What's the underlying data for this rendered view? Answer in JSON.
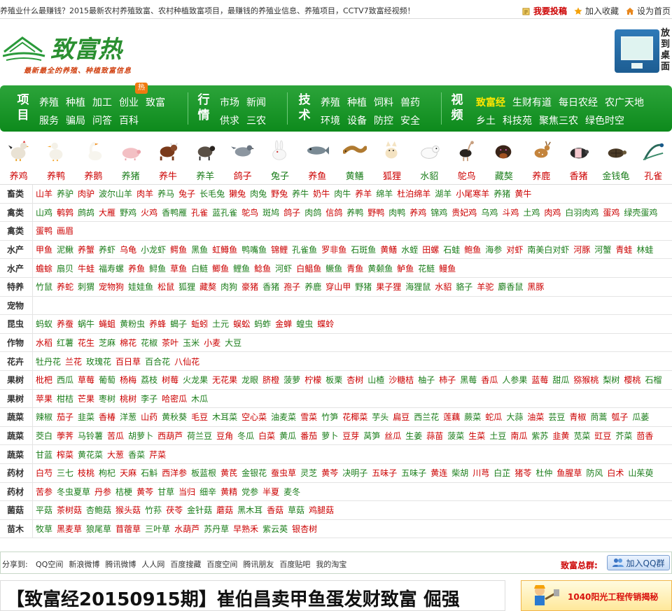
{
  "topbar": {
    "intro": "养殖业什么最赚钱？2015最新农村养殖致富、农村种植致富项目，最赚钱的养殖业信息、养殖项目，CCTV7致富经视频！",
    "submit": "我要投稿",
    "favorite": "加入收藏",
    "homepage": "设为首页"
  },
  "header": {
    "logo_slogan": "最新最全的养殖、种植致富信息",
    "desktop_label": "放到桌面"
  },
  "nav": {
    "groups": [
      {
        "title": "项目",
        "r1": [
          "养殖",
          "种植",
          "加工",
          "创业",
          "致富"
        ],
        "r2": [
          "服务",
          "骗局",
          "问答",
          "百科"
        ]
      },
      {
        "title": "行情",
        "r1": [
          "市场",
          "新闻"
        ],
        "r2": [
          "供求",
          "三农"
        ]
      },
      {
        "title": "技术",
        "r1": [
          "养殖",
          "种植",
          "饲料",
          "兽药"
        ],
        "r2": [
          "环境",
          "设备",
          "防控",
          "安全"
        ]
      },
      {
        "title": "视频",
        "r1": [
          "致富经",
          "生财有道",
          "每日农经",
          "农广天地"
        ],
        "r2": [
          "乡土",
          "科技苑",
          "聚焦三农",
          "绿色时空"
        ]
      }
    ],
    "hot_badge": "热"
  },
  "animals": [
    {
      "label": "养鸡",
      "color": "red",
      "icon": "chicken-icon"
    },
    {
      "label": "养鸭",
      "color": "red",
      "icon": "duck-icon"
    },
    {
      "label": "养鹅",
      "color": "red",
      "icon": "goose-icon"
    },
    {
      "label": "养猪",
      "color": "grn",
      "icon": "pig-icon"
    },
    {
      "label": "养牛",
      "color": "red",
      "icon": "cow-icon"
    },
    {
      "label": "养羊",
      "color": "grn",
      "icon": "sheep-icon"
    },
    {
      "label": "鸽子",
      "color": "red",
      "icon": "pigeon-icon"
    },
    {
      "label": "兔子",
      "color": "grn",
      "icon": "rabbit-icon"
    },
    {
      "label": "养鱼",
      "color": "red",
      "icon": "fish-icon"
    },
    {
      "label": "黄鳝",
      "color": "grn",
      "icon": "eel-icon"
    },
    {
      "label": "狐狸",
      "color": "red",
      "icon": "fox-icon"
    },
    {
      "label": "水貂",
      "color": "grn",
      "icon": "mink-icon"
    },
    {
      "label": "鸵鸟",
      "color": "red",
      "icon": "ostrich-icon"
    },
    {
      "label": "藏獒",
      "color": "grn",
      "icon": "mastiff-icon"
    },
    {
      "label": "养鹿",
      "color": "red",
      "icon": "deer-icon"
    },
    {
      "label": "香猪",
      "color": "red",
      "icon": "minipig-icon"
    },
    {
      "label": "金钱龟",
      "color": "grn",
      "icon": "turtle-icon"
    },
    {
      "label": "孔雀",
      "color": "red",
      "icon": "peacock-icon"
    }
  ],
  "categories": [
    {
      "label": "畜类",
      "items": [
        [
          "山羊",
          "r"
        ],
        [
          "养驴",
          "g"
        ],
        [
          "肉驴",
          "r"
        ],
        [
          "波尔山羊",
          "g"
        ],
        [
          "肉羊",
          "r"
        ],
        [
          "养马",
          "g"
        ],
        [
          "兔子",
          "r"
        ],
        [
          "长毛兔",
          "g"
        ],
        [
          "獭兔",
          "r"
        ],
        [
          "肉兔",
          "g"
        ],
        [
          "野兔",
          "r"
        ],
        [
          "养牛",
          "g"
        ],
        [
          "奶牛",
          "r"
        ],
        [
          "肉牛",
          "g"
        ],
        [
          "养羊",
          "r"
        ],
        [
          "绵羊",
          "g"
        ],
        [
          "杜泊绵羊",
          "r"
        ],
        [
          "湖羊",
          "g"
        ],
        [
          "小尾寒羊",
          "r"
        ],
        [
          "养猪",
          "g"
        ],
        [
          "黄牛",
          "r"
        ]
      ]
    },
    {
      "label": "禽类",
      "items": [
        [
          "山鸡",
          "g"
        ],
        [
          "鹌鹑",
          "r"
        ],
        [
          "鹧鸪",
          "g"
        ],
        [
          "大雁",
          "r"
        ],
        [
          "野鸡",
          "g"
        ],
        [
          "火鸡",
          "r"
        ],
        [
          "香鸭雁",
          "g"
        ],
        [
          "孔雀",
          "r"
        ],
        [
          "蓝孔雀",
          "g"
        ],
        [
          "鸵鸟",
          "r"
        ],
        [
          "斑鸠",
          "g"
        ],
        [
          "鸽子",
          "r"
        ],
        [
          "肉鸽",
          "g"
        ],
        [
          "信鸽",
          "r"
        ],
        [
          "养鸭",
          "g"
        ],
        [
          "野鸭",
          "r"
        ],
        [
          "肉鸭",
          "g"
        ],
        [
          "养鸡",
          "r"
        ],
        [
          "锦鸡",
          "g"
        ],
        [
          "贵妃鸡",
          "r"
        ],
        [
          "乌鸡",
          "g"
        ],
        [
          "斗鸡",
          "r"
        ],
        [
          "土鸡",
          "g"
        ],
        [
          "肉鸡",
          "r"
        ],
        [
          "白羽肉鸡",
          "g"
        ],
        [
          "蛋鸡",
          "r"
        ],
        [
          "绿壳蛋鸡",
          "g"
        ]
      ]
    },
    {
      "label": "禽类",
      "items": [
        [
          "蛋鸭",
          "r"
        ],
        [
          "画眉",
          "r"
        ]
      ]
    },
    {
      "label": "水产",
      "items": [
        [
          "甲鱼",
          "r"
        ],
        [
          "泥鳅",
          "g"
        ],
        [
          "养蟹",
          "r"
        ],
        [
          "养虾",
          "g"
        ],
        [
          "乌龟",
          "r"
        ],
        [
          "小龙虾",
          "g"
        ],
        [
          "鳄鱼",
          "r"
        ],
        [
          "黑鱼",
          "g"
        ],
        [
          "虹鳟鱼",
          "r"
        ],
        [
          "鸭嘴鱼",
          "g"
        ],
        [
          "锦鲤",
          "r"
        ],
        [
          "孔雀鱼",
          "g"
        ],
        [
          "罗非鱼",
          "r"
        ],
        [
          "石斑鱼",
          "g"
        ],
        [
          "黄鳝",
          "r"
        ],
        [
          "水蛭",
          "g"
        ],
        [
          "田螺",
          "r"
        ],
        [
          "石蛙",
          "g"
        ],
        [
          "鲍鱼",
          "r"
        ],
        [
          "海参",
          "g"
        ],
        [
          "对虾",
          "r"
        ],
        [
          "南美白对虾",
          "g"
        ],
        [
          "河豚",
          "r"
        ],
        [
          "河蟹",
          "g"
        ],
        [
          "青蛙",
          "r"
        ],
        [
          "林蛙",
          "g"
        ]
      ]
    },
    {
      "label": "水产",
      "items": [
        [
          "蟾蜍",
          "r"
        ],
        [
          "扇贝",
          "g"
        ],
        [
          "牛蛙",
          "r"
        ],
        [
          "福寿螺",
          "g"
        ],
        [
          "养鱼",
          "r"
        ],
        [
          "鲟鱼",
          "g"
        ],
        [
          "草鱼",
          "r"
        ],
        [
          "白鲢",
          "g"
        ],
        [
          "鲫鱼",
          "r"
        ],
        [
          "鲤鱼",
          "g"
        ],
        [
          "鲶鱼",
          "r"
        ],
        [
          "河虾",
          "g"
        ],
        [
          "白鲳鱼",
          "r"
        ],
        [
          "鳜鱼",
          "g"
        ],
        [
          "青鱼",
          "r"
        ],
        [
          "黄颡鱼",
          "g"
        ],
        [
          "鲈鱼",
          "r"
        ],
        [
          "花鲢",
          "g"
        ],
        [
          "鳗鱼",
          "r"
        ]
      ]
    },
    {
      "label": "特养",
      "items": [
        [
          "竹鼠",
          "g"
        ],
        [
          "养蛇",
          "r"
        ],
        [
          "刺猬",
          "g"
        ],
        [
          "宠物狗",
          "r"
        ],
        [
          "娃娃鱼",
          "g"
        ],
        [
          "松鼠",
          "r"
        ],
        [
          "狐狸",
          "g"
        ],
        [
          "藏獒",
          "r"
        ],
        [
          "肉狗",
          "g"
        ],
        [
          "豪猪",
          "r"
        ],
        [
          "香猪",
          "g"
        ],
        [
          "孢子",
          "r"
        ],
        [
          "养鹿",
          "g"
        ],
        [
          "穿山甲",
          "r"
        ],
        [
          "野猪",
          "g"
        ],
        [
          "果子狸",
          "r"
        ],
        [
          "海狸鼠",
          "g"
        ],
        [
          "水貂",
          "r"
        ],
        [
          "貉子",
          "g"
        ],
        [
          "羊驼",
          "r"
        ],
        [
          "麝香鼠",
          "g"
        ],
        [
          "黑豚",
          "r"
        ]
      ]
    },
    {
      "label": "宠物",
      "items": []
    },
    {
      "label": "昆虫",
      "items": [
        [
          "蚂蚁",
          "g"
        ],
        [
          "养蚕",
          "r"
        ],
        [
          "蜗牛",
          "g"
        ],
        [
          "蝇蛆",
          "r"
        ],
        [
          "黄粉虫",
          "g"
        ],
        [
          "养蜂",
          "r"
        ],
        [
          "蝎子",
          "g"
        ],
        [
          "蚯蚓",
          "r"
        ],
        [
          "土元",
          "g"
        ],
        [
          "蜈蚣",
          "r"
        ],
        [
          "蚂蚱",
          "g"
        ],
        [
          "金蝉",
          "r"
        ],
        [
          "蝗虫",
          "g"
        ],
        [
          "蝶蛉",
          "r"
        ]
      ]
    },
    {
      "label": "作物",
      "items": [
        [
          "水稻",
          "r"
        ],
        [
          "红薯",
          "g"
        ],
        [
          "花生",
          "r"
        ],
        [
          "芝麻",
          "g"
        ],
        [
          "棉花",
          "r"
        ],
        [
          "花椒",
          "g"
        ],
        [
          "茶叶",
          "r"
        ],
        [
          "玉米",
          "g"
        ],
        [
          "小麦",
          "r"
        ],
        [
          "大豆",
          "g"
        ]
      ]
    },
    {
      "label": "花卉",
      "items": [
        [
          "牡丹花",
          "g"
        ],
        [
          "兰花",
          "r"
        ],
        [
          "玫瑰花",
          "g"
        ],
        [
          "百日草",
          "r"
        ],
        [
          "百合花",
          "g"
        ],
        [
          "八仙花",
          "r"
        ]
      ]
    },
    {
      "label": "果树",
      "items": [
        [
          "枇杷",
          "r"
        ],
        [
          "西瓜",
          "g"
        ],
        [
          "草莓",
          "r"
        ],
        [
          "葡萄",
          "g"
        ],
        [
          "杨梅",
          "r"
        ],
        [
          "荔枝",
          "g"
        ],
        [
          "树莓",
          "r"
        ],
        [
          "火龙果",
          "g"
        ],
        [
          "无花果",
          "r"
        ],
        [
          "龙眼",
          "g"
        ],
        [
          "脐橙",
          "r"
        ],
        [
          "菠萝",
          "g"
        ],
        [
          "柠檬",
          "r"
        ],
        [
          "板栗",
          "g"
        ],
        [
          "杏树",
          "r"
        ],
        [
          "山楂",
          "g"
        ],
        [
          "沙糖桔",
          "r"
        ],
        [
          "柚子",
          "g"
        ],
        [
          "柿子",
          "r"
        ],
        [
          "黑莓",
          "g"
        ],
        [
          "香瓜",
          "r"
        ],
        [
          "人参果",
          "g"
        ],
        [
          "蓝莓",
          "r"
        ],
        [
          "甜瓜",
          "g"
        ],
        [
          "猕猴桃",
          "r"
        ],
        [
          "梨树",
          "g"
        ],
        [
          "樱桃",
          "r"
        ],
        [
          "石榴",
          "g"
        ]
      ]
    },
    {
      "label": "果树",
      "items": [
        [
          "苹果",
          "r"
        ],
        [
          "柑桔",
          "g"
        ],
        [
          "芒果",
          "r"
        ],
        [
          "枣树",
          "g"
        ],
        [
          "桃树",
          "r"
        ],
        [
          "李子",
          "g"
        ],
        [
          "哈密瓜",
          "r"
        ],
        [
          "木瓜",
          "g"
        ]
      ]
    },
    {
      "label": "蔬菜",
      "items": [
        [
          "辣椒",
          "g"
        ],
        [
          "茄子",
          "r"
        ],
        [
          "韭菜",
          "g"
        ],
        [
          "香椿",
          "r"
        ],
        [
          "洋葱",
          "g"
        ],
        [
          "山药",
          "r"
        ],
        [
          "黄秋葵",
          "g"
        ],
        [
          "毛豆",
          "r"
        ],
        [
          "木耳菜",
          "g"
        ],
        [
          "空心菜",
          "r"
        ],
        [
          "油麦菜",
          "g"
        ],
        [
          "雪菜",
          "r"
        ],
        [
          "竹笋",
          "g"
        ],
        [
          "花椰菜",
          "r"
        ],
        [
          "芋头",
          "g"
        ],
        [
          "扁豆",
          "r"
        ],
        [
          "西兰花",
          "g"
        ],
        [
          "莲藕",
          "r"
        ],
        [
          "蕨菜",
          "g"
        ],
        [
          "蛇瓜",
          "r"
        ],
        [
          "大蒜",
          "g"
        ],
        [
          "油菜",
          "r"
        ],
        [
          "芸豆",
          "g"
        ],
        [
          "青椒",
          "r"
        ],
        [
          "茼蒿",
          "g"
        ],
        [
          "瓠子",
          "r"
        ],
        [
          "瓜蒌",
          "g"
        ]
      ]
    },
    {
      "label": "蔬菜",
      "items": [
        [
          "茭白",
          "g"
        ],
        [
          "荸荠",
          "r"
        ],
        [
          "马铃薯",
          "g"
        ],
        [
          "苦瓜",
          "r"
        ],
        [
          "胡萝卜",
          "g"
        ],
        [
          "西葫芦",
          "r"
        ],
        [
          "荷兰豆",
          "g"
        ],
        [
          "豆角",
          "r"
        ],
        [
          "冬瓜",
          "g"
        ],
        [
          "白菜",
          "r"
        ],
        [
          "黄瓜",
          "g"
        ],
        [
          "番茄",
          "r"
        ],
        [
          "萝卜",
          "g"
        ],
        [
          "豆芽",
          "r"
        ],
        [
          "莴笋",
          "g"
        ],
        [
          "丝瓜",
          "r"
        ],
        [
          "生姜",
          "g"
        ],
        [
          "蒜苗",
          "r"
        ],
        [
          "菠菜",
          "g"
        ],
        [
          "生菜",
          "r"
        ],
        [
          "土豆",
          "g"
        ],
        [
          "南瓜",
          "r"
        ],
        [
          "紫苏",
          "g"
        ],
        [
          "韭黄",
          "r"
        ],
        [
          "苋菜",
          "g"
        ],
        [
          "豇豆",
          "r"
        ],
        [
          "芥菜",
          "g"
        ],
        [
          "茴香",
          "r"
        ]
      ]
    },
    {
      "label": "蔬菜",
      "items": [
        [
          "甘蓝",
          "g"
        ],
        [
          "榨菜",
          "r"
        ],
        [
          "黄花菜",
          "g"
        ],
        [
          "大葱",
          "r"
        ],
        [
          "香菜",
          "g"
        ],
        [
          "芹菜",
          "r"
        ]
      ]
    },
    {
      "label": "药材",
      "items": [
        [
          "白芍",
          "r"
        ],
        [
          "三七",
          "g"
        ],
        [
          "枝桃",
          "r"
        ],
        [
          "枸杞",
          "g"
        ],
        [
          "天麻",
          "r"
        ],
        [
          "石斛",
          "g"
        ],
        [
          "西洋参",
          "r"
        ],
        [
          "板蓝根",
          "g"
        ],
        [
          "黄芪",
          "r"
        ],
        [
          "金银花",
          "g"
        ],
        [
          "蚕虫草",
          "r"
        ],
        [
          "灵芝",
          "g"
        ],
        [
          "黄芩",
          "r"
        ],
        [
          "决明子",
          "g"
        ],
        [
          "五味子",
          "r"
        ],
        [
          "五味子",
          "g"
        ],
        [
          "黄连",
          "r"
        ],
        [
          "柴胡",
          "g"
        ],
        [
          "川芎",
          "r"
        ],
        [
          "白芷",
          "g"
        ],
        [
          "猪苓",
          "r"
        ],
        [
          "杜仲",
          "g"
        ],
        [
          "鱼腥草",
          "r"
        ],
        [
          "防风",
          "g"
        ],
        [
          "白术",
          "r"
        ],
        [
          "山茱萸",
          "g"
        ]
      ]
    },
    {
      "label": "药材",
      "items": [
        [
          "苦参",
          "r"
        ],
        [
          "冬虫夏草",
          "g"
        ],
        [
          "丹参",
          "r"
        ],
        [
          "桔梗",
          "g"
        ],
        [
          "黄芩",
          "r"
        ],
        [
          "甘草",
          "g"
        ],
        [
          "当归",
          "r"
        ],
        [
          "细辛",
          "g"
        ],
        [
          "黄精",
          "r"
        ],
        [
          "党参",
          "g"
        ],
        [
          "半夏",
          "r"
        ],
        [
          "麦冬",
          "g"
        ]
      ]
    },
    {
      "label": "菌菇",
      "items": [
        [
          "平菇",
          "g"
        ],
        [
          "茶树菇",
          "r"
        ],
        [
          "杏鲍菇",
          "g"
        ],
        [
          "猴头菇",
          "r"
        ],
        [
          "竹荪",
          "g"
        ],
        [
          "茯苓",
          "r"
        ],
        [
          "金针菇",
          "g"
        ],
        [
          "蘑菇",
          "r"
        ],
        [
          "黑木耳",
          "g"
        ],
        [
          "香菇",
          "r"
        ],
        [
          "草菇",
          "g"
        ],
        [
          "鸡腿菇",
          "r"
        ]
      ]
    },
    {
      "label": "苗木",
      "items": [
        [
          "牧草",
          "g"
        ],
        [
          "黑麦草",
          "r"
        ],
        [
          "狼尾草",
          "g"
        ],
        [
          "苜蓿草",
          "r"
        ],
        [
          "三叶草",
          "g"
        ],
        [
          "水葫芦",
          "r"
        ],
        [
          "苏丹草",
          "g"
        ],
        [
          "早熟禾",
          "r"
        ],
        [
          "紫云英",
          "g"
        ],
        [
          "银杏树",
          "r"
        ]
      ]
    }
  ],
  "share": {
    "label": "分享到:",
    "links": [
      "QQ空间",
      "新浪微博",
      "腾讯微博",
      "人人网",
      "百度搜藏",
      "百度空间",
      "腾讯朋友",
      "百度贴吧",
      "我的淘宝"
    ],
    "group_label": "致富总群:",
    "qq_button": "加入QQ群"
  },
  "headline": "【致富经20150915期】崔伯昌卖甲鱼蛋发财致富 倔强",
  "ad": "1040阳光工程传销揭秘",
  "colors": {
    "nav_green": "#0d8a1c",
    "red": "#cc0000",
    "green": "#1a7d1a",
    "yellow": "#ffe600"
  }
}
